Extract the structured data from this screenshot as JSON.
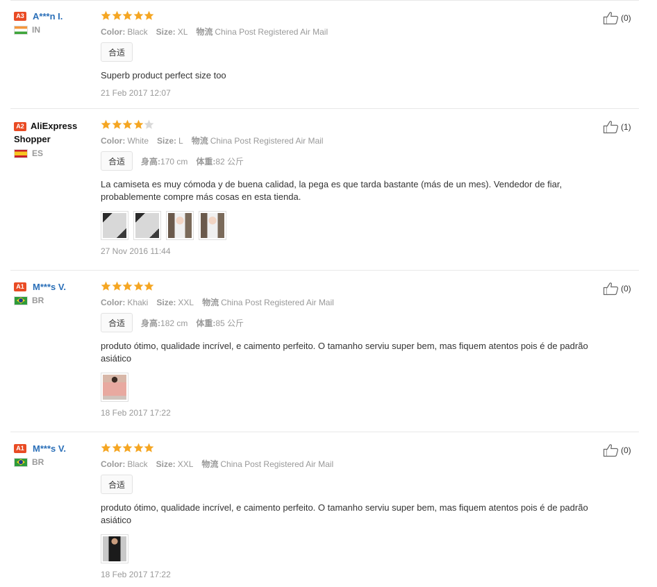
{
  "colors": {
    "accent_star": "#f5a623",
    "badge": "#e94b24",
    "username": "#2a6fb8",
    "muted": "#999999"
  },
  "labels": {
    "color": "Color:",
    "size": "Size:",
    "shipping": "物流",
    "height": "身高:",
    "weight": "体重:"
  },
  "reviews": [
    {
      "level": "A3",
      "name": "A***n I.",
      "name_style": "link",
      "country": "IN",
      "flag": "IN",
      "stars": 5,
      "helpful": "(0)",
      "color": "Black",
      "size": "XL",
      "shipping": "China Post Registered Air Mail",
      "tag": "合适",
      "height": "",
      "weight": "",
      "text": "Superb product perfect size too",
      "images": [],
      "date": "21 Feb 2017 12:07"
    },
    {
      "level": "A2",
      "name": "AliExpress Shopper",
      "name_style": "dark",
      "country": "ES",
      "flag": "ES",
      "stars": 4,
      "helpful": "(1)",
      "color": "White",
      "size": "L",
      "shipping": "China Post Registered Air Mail",
      "tag": "合适",
      "height": "170 cm",
      "weight": "82 公斤",
      "text": "La camiseta es muy cómoda y de buena calidad, la pega es que tarda bastante (más de un mes). Vendedor de fiar, probablemente compre más cosas en esta tienda.",
      "images": [
        "white-shirt-photo",
        "white-shirt-photo",
        "person-wearing-shirt-photo",
        "person-wearing-shirt-photo"
      ],
      "date": "27 Nov 2016 11:44"
    },
    {
      "level": "A1",
      "name": "M***s V.",
      "name_style": "link",
      "country": "BR",
      "flag": "BR",
      "stars": 5,
      "helpful": "(0)",
      "color": "Khaki",
      "size": "XXL",
      "shipping": "China Post Registered Air Mail",
      "tag": "合适",
      "height": "182 cm",
      "weight": "85 公斤",
      "text": "produto ótimo, qualidade incrível, e caimento perfeito. O tamanho serviu super bem, mas fiquem atentos pois é de padrão asiático",
      "images": [
        "khaki-shirt-photo"
      ],
      "date": "18 Feb 2017 17:22"
    },
    {
      "level": "A1",
      "name": "M***s V.",
      "name_style": "link",
      "country": "BR",
      "flag": "BR",
      "stars": 5,
      "helpful": "(0)",
      "color": "Black",
      "size": "XXL",
      "shipping": "China Post Registered Air Mail",
      "tag": "合适",
      "height": "",
      "weight": "",
      "text": "produto ótimo, qualidade incrível, e caimento perfeito. O tamanho serviu super bem, mas fiquem atentos pois é de padrão asiático",
      "images": [
        "black-shirt-photo"
      ],
      "date": "18 Feb 2017 17:22"
    }
  ]
}
